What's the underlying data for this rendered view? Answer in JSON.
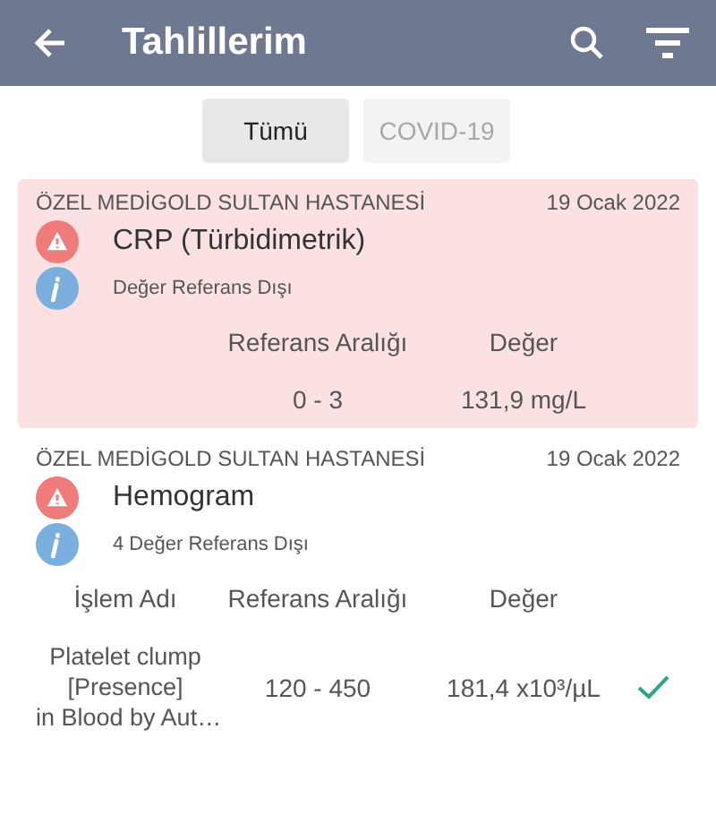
{
  "app_bar": {
    "title": "Tahlillerim"
  },
  "filters": [
    {
      "label": "Tümü",
      "selected": true
    },
    {
      "label": "COVID-19",
      "selected": false
    }
  ],
  "results": [
    {
      "hospital": "ÖZEL MEDİGOLD SULTAN HASTANESİ",
      "date": "19 Ocak 2022",
      "test": "CRP (Türbidimetrik)",
      "note": "Değer Referans Dışı",
      "highlighted": true,
      "columns": [
        {
          "kind": "reference",
          "label": "Referans Aralığı"
        },
        {
          "kind": "value",
          "label": "Değer"
        }
      ],
      "rows": [
        {
          "reference": "0 - 3",
          "value": "131,9 mg/L",
          "in_range": false
        }
      ]
    },
    {
      "hospital": "ÖZEL MEDİGOLD SULTAN HASTANESİ",
      "date": "19 Ocak 2022",
      "test": "Hemogram",
      "note": "4 Değer Referans Dışı",
      "highlighted": false,
      "columns": [
        {
          "kind": "name",
          "label": "İşlem Adı"
        },
        {
          "kind": "reference",
          "label": "Referans Aralığı"
        },
        {
          "kind": "value",
          "label": "Değer"
        }
      ],
      "rows": [
        {
          "name_lines": [
            "Platelet clump",
            "[Presence]",
            "in Blood by Aut…"
          ],
          "reference": "120 - 450",
          "value": "181,4 x10³/µL",
          "in_range": true
        }
      ]
    }
  ]
}
